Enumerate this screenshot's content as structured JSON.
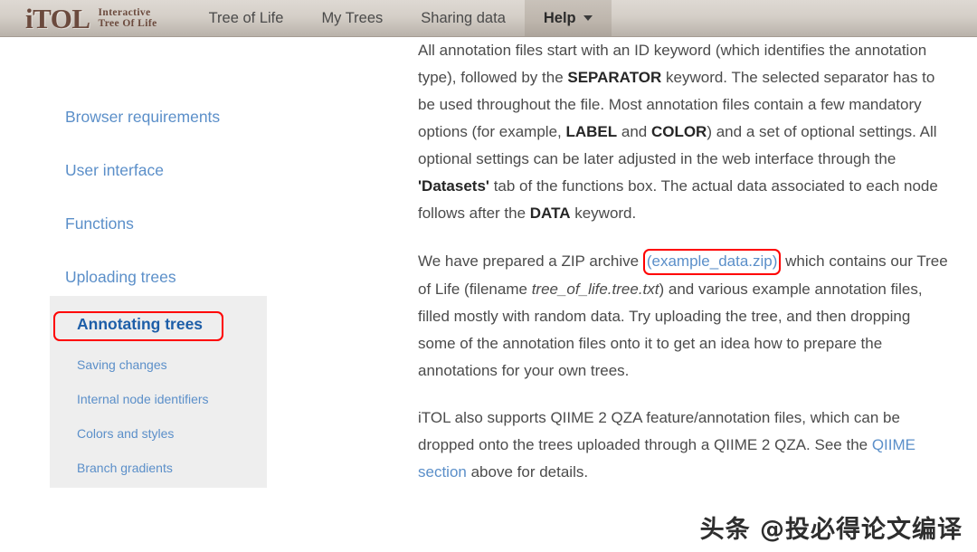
{
  "navbar": {
    "logo_main": "iTOL",
    "logo_sub_line1": "Interactive",
    "logo_sub_line2": "Tree Of Life",
    "items": [
      {
        "label": "Tree of Life",
        "active": false
      },
      {
        "label": "My Trees",
        "active": false
      },
      {
        "label": "Sharing data",
        "active": false
      },
      {
        "label": "Help",
        "active": true,
        "has_caret": true
      }
    ]
  },
  "sidebar": {
    "top_items": [
      {
        "label": "Browser requirements"
      },
      {
        "label": "User interface"
      },
      {
        "label": "Functions"
      },
      {
        "label": "Uploading trees"
      }
    ],
    "current_item": {
      "label": "Annotating trees",
      "highlighted": true
    },
    "sub_items": [
      {
        "label": "Saving changes"
      },
      {
        "label": "Internal node identifiers"
      },
      {
        "label": "Colors and styles"
      },
      {
        "label": "Branch gradients"
      }
    ]
  },
  "content": {
    "paragraph1": {
      "seg1": "All annotation files start with an ID keyword (which identifies the annotation type), followed by the ",
      "bold1": "SEPARATOR",
      "seg2": " keyword. The selected separator has to be used throughout the file. Most annotation files contain a few mandatory options (for example, ",
      "bold2": "LABEL",
      "seg3": " and ",
      "bold3": "COLOR",
      "seg4": ") and a set of optional settings. All optional settings can be later adjusted in the web interface through the ",
      "bold4": "'Datasets'",
      "seg5": " tab of the functions box. The actual data associated to each node follows after the ",
      "bold5": "DATA",
      "seg6": " keyword."
    },
    "paragraph2": {
      "seg1": "We have prepared a ZIP archive ",
      "link": "(example_data.zip)",
      "seg2": " which contains our Tree of Life (filename ",
      "italic1": "tree_of_life.tree.txt",
      "seg3": ") and various example annotation files, filled mostly with random data. Try uploading the tree, and then dropping some of the annotation files onto it to get an idea how to prepare the annotations for your own trees."
    },
    "paragraph3": {
      "seg1": "iTOL also supports QIIME 2 QZA feature/annotation files, which can be dropped onto the trees uploaded through a QIIME 2 QZA. See the ",
      "link": "QIIME section",
      "seg2": " above for details."
    }
  },
  "annotations": {
    "highlight_color": "#ff0000"
  },
  "watermark": {
    "text": "头条 @投必得论文编译"
  },
  "colors": {
    "link_blue": "#5b8fc9",
    "active_link_blue": "#1d5ea8",
    "navbar_light": "#ded9d3",
    "navbar_dark": "#b9b2aa",
    "brand_brown": "#6b4a3d",
    "panel_gray": "#eeeeee",
    "body_text": "#4b4b4b"
  }
}
